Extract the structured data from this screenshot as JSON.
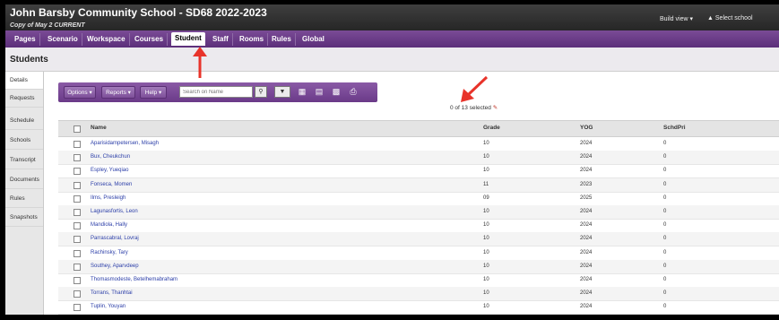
{
  "header": {
    "title": "John Barsby Community School - SD68 2022-2023",
    "subtitle": "Copy of May 2 CURRENT",
    "build_view": "Build view ▾",
    "select_school": "Select school"
  },
  "tabs": [
    {
      "label": "Pages"
    },
    {
      "label": "Scenario"
    },
    {
      "label": "Workspace"
    },
    {
      "label": "Courses"
    },
    {
      "label": "Student"
    },
    {
      "label": "Staff"
    },
    {
      "label": "Rooms"
    },
    {
      "label": "Rules"
    },
    {
      "label": "Global"
    }
  ],
  "active_tab": "Student",
  "page": {
    "title": "Students"
  },
  "sidebar": {
    "items": [
      {
        "label": "Details"
      },
      {
        "label": "Requests"
      },
      {
        "label": "Schedule"
      },
      {
        "label": "Schools"
      },
      {
        "label": "Transcript"
      },
      {
        "label": "Documents"
      },
      {
        "label": "Rules"
      },
      {
        "label": "Snapshots"
      }
    ]
  },
  "toolbar": {
    "options_label": "Options ▾",
    "reports_label": "Reports ▾",
    "help_label": "Help ▾",
    "search_placeholder": "Search on Name"
  },
  "selection": {
    "text": "0 of 13 selected"
  },
  "table": {
    "columns": [
      "Name",
      "Grade",
      "YOG",
      "SchdPri"
    ],
    "rows": [
      [
        "Aparisidampetersen, Misagh",
        "10",
        "2024",
        "0"
      ],
      [
        "Bux, Cheukchun",
        "10",
        "2024",
        "0"
      ],
      [
        "Espley, Yueqiao",
        "10",
        "2024",
        "0"
      ],
      [
        "Fonseca, Momen",
        "11",
        "2023",
        "0"
      ],
      [
        "Ilms, Presleigh",
        "09",
        "2025",
        "0"
      ],
      [
        "Lagunasfortis, Leon",
        "10",
        "2024",
        "0"
      ],
      [
        "Mandiola, Hally",
        "10",
        "2024",
        "0"
      ],
      [
        "Parrascabral, Lovraj",
        "10",
        "2024",
        "0"
      ],
      [
        "Rachinsky, Tary",
        "10",
        "2024",
        "0"
      ],
      [
        "Southey, Aparvdeep",
        "10",
        "2024",
        "0"
      ],
      [
        "Thomasmodeste, Betelhemabraham",
        "10",
        "2024",
        "0"
      ],
      [
        "Torrans, Thanhtai",
        "10",
        "2024",
        "0"
      ],
      [
        "Tuplin, Youyan",
        "10",
        "2024",
        "0"
      ]
    ]
  },
  "colors": {
    "header_bg": "#2f2f2f",
    "tab_bar": "#6b3d88",
    "link": "#2b3ea8",
    "annotation_arrow": "#e8332a"
  }
}
